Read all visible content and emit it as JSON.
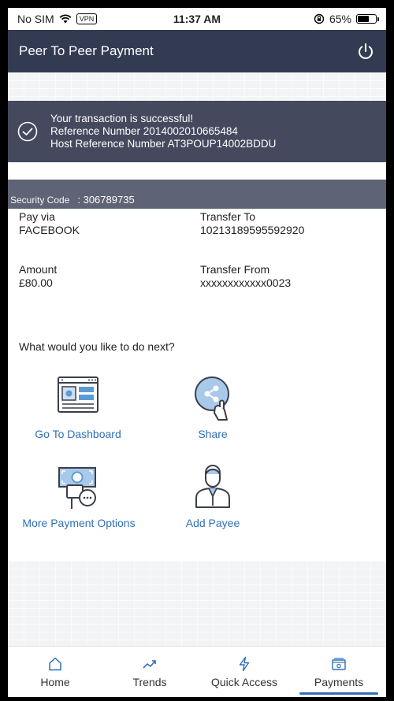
{
  "status_bar": {
    "carrier": "No SIM",
    "vpn": "VPN",
    "time": "11:37 AM",
    "battery": "65%",
    "battery_level": 0.65
  },
  "header": {
    "title": "Peer To Peer Payment",
    "power_icon": "power-icon"
  },
  "banner": {
    "message": "Your transaction is successful!",
    "reference": "Reference Number 2014002010665484",
    "host_reference": "Host Reference Number AT3POUP14002BDDU"
  },
  "security": {
    "label": "Security Code",
    "value": ": 306789735"
  },
  "details": {
    "pay_via_label": "Pay via",
    "pay_via_value": "FACEBOOK",
    "transfer_to_label": "Transfer To",
    "transfer_to_value": "10213189595592920",
    "amount_label": "Amount",
    "amount_value": "£80.00",
    "transfer_from_label": "Transfer From",
    "transfer_from_value": "xxxxxxxxxxxx0023"
  },
  "next": {
    "question": "What would you like to do next?",
    "actions": [
      {
        "label": "Go To Dashboard",
        "icon": "dashboard-icon"
      },
      {
        "label": "Share",
        "icon": "share-icon"
      },
      {
        "label": "More Payment Options",
        "icon": "payment-options-icon"
      },
      {
        "label": "Add Payee",
        "icon": "add-payee-icon"
      }
    ]
  },
  "nav": {
    "items": [
      {
        "label": "Home",
        "icon": "home-icon"
      },
      {
        "label": "Trends",
        "icon": "trends-icon"
      },
      {
        "label": "Quick Access",
        "icon": "lightning-icon"
      },
      {
        "label": "Payments",
        "icon": "payments-icon"
      }
    ],
    "active": "Payments"
  },
  "colors": {
    "header_bg": "#333b53",
    "banner_bg": "#44495e",
    "security_bg": "#5e6475",
    "link": "#2f6fb8",
    "accent": "#2f6fb8"
  }
}
